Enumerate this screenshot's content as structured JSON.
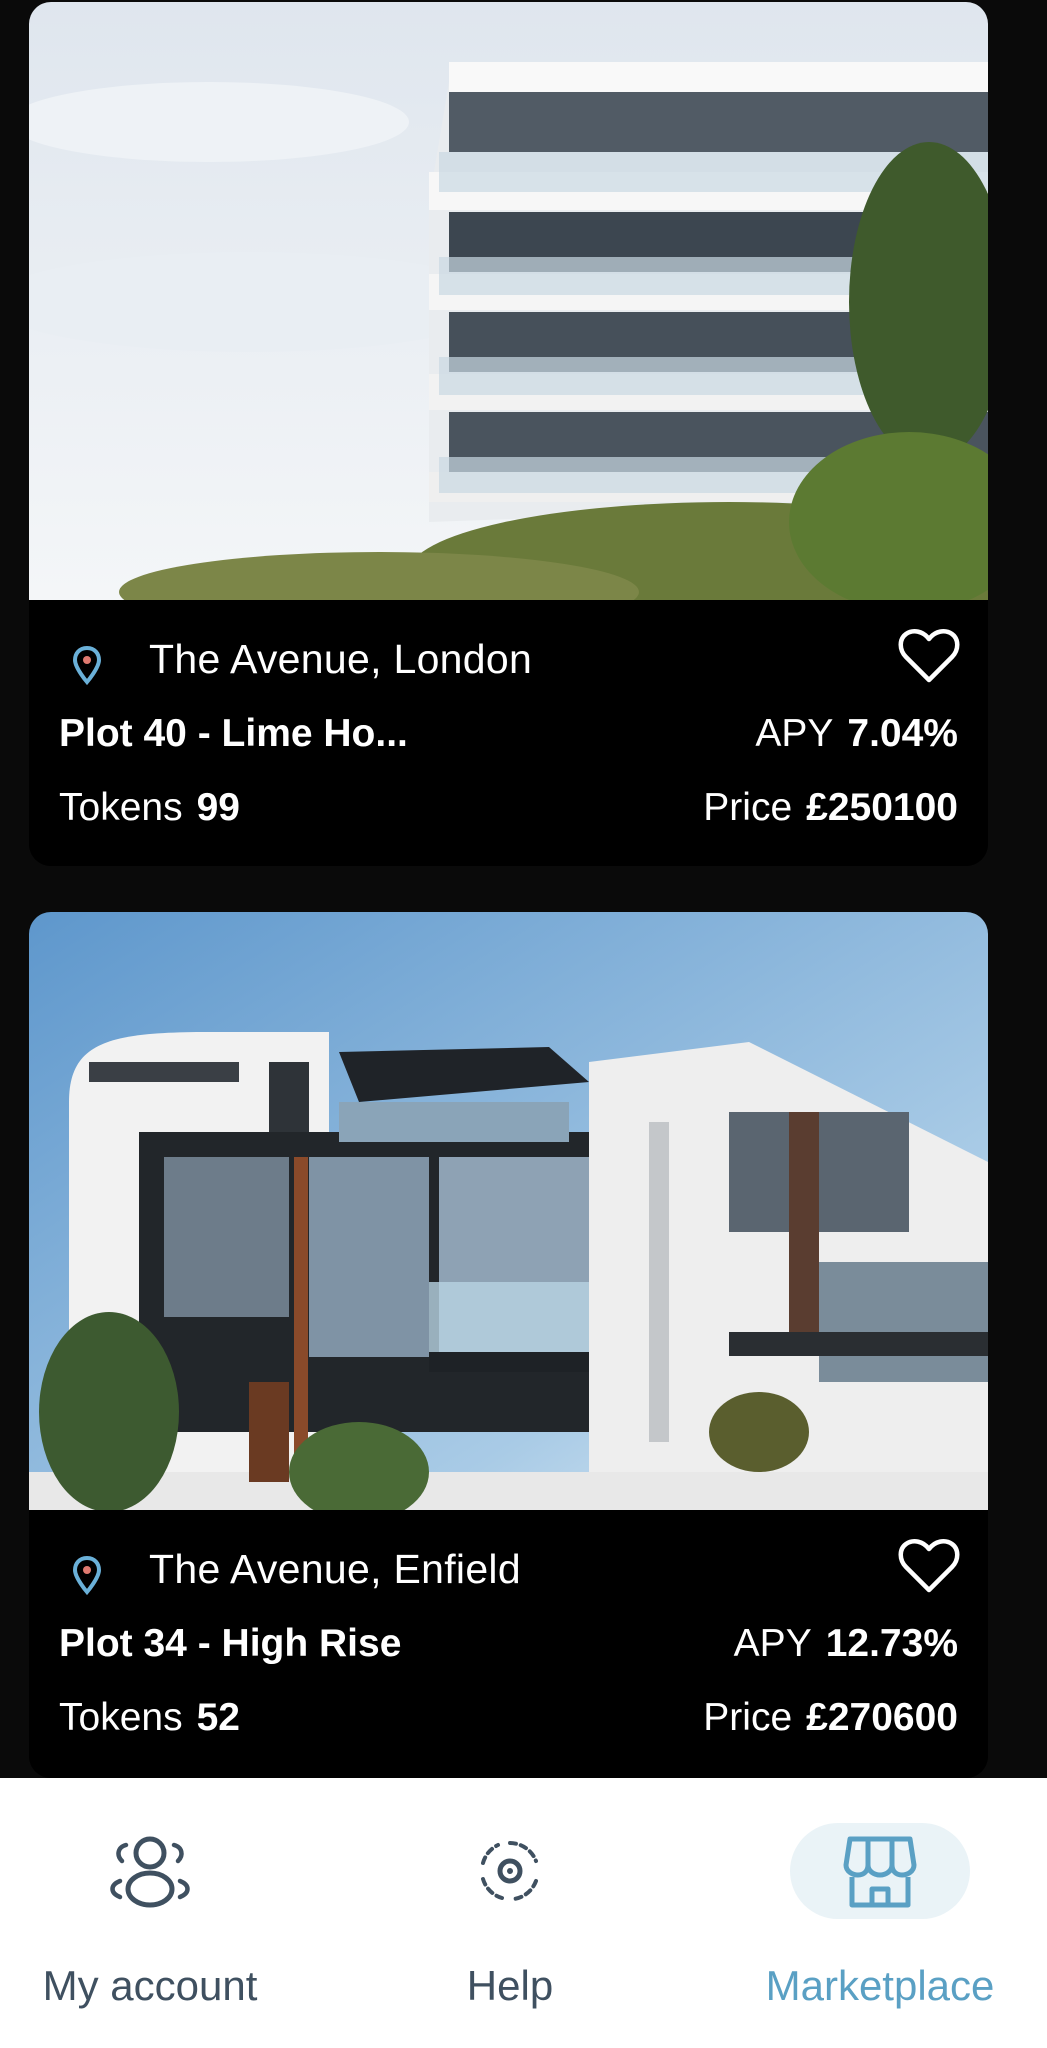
{
  "listings": [
    {
      "location": "The Avenue, London",
      "title": "Plot 40 - Lime Ho...",
      "apy_label": "APY",
      "apy_value": "7.04%",
      "tokens_label": "Tokens",
      "tokens_value": "99",
      "price_label": "Price",
      "price_value": "£250100"
    },
    {
      "location": "The Avenue, Enfield",
      "title": "Plot 34 - High Rise",
      "apy_label": "APY",
      "apy_value": "12.73%",
      "tokens_label": "Tokens",
      "tokens_value": "52",
      "price_label": "Price",
      "price_value": "£270600"
    }
  ],
  "nav": {
    "account_label": "My account",
    "help_label": "Help",
    "marketplace_label": "Marketplace",
    "active": "marketplace"
  },
  "icons": {
    "location": "location-pin-icon",
    "favorite": "heart-outline-icon",
    "account": "users-icon",
    "help": "support-icon",
    "marketplace": "storefront-icon"
  },
  "colors": {
    "background": "#0a0a0a",
    "card_info": "#000000",
    "nav_active": "#5aa0c4",
    "nav_inactive": "#3f5060",
    "nav_active_bg": "#eaf3f7"
  }
}
